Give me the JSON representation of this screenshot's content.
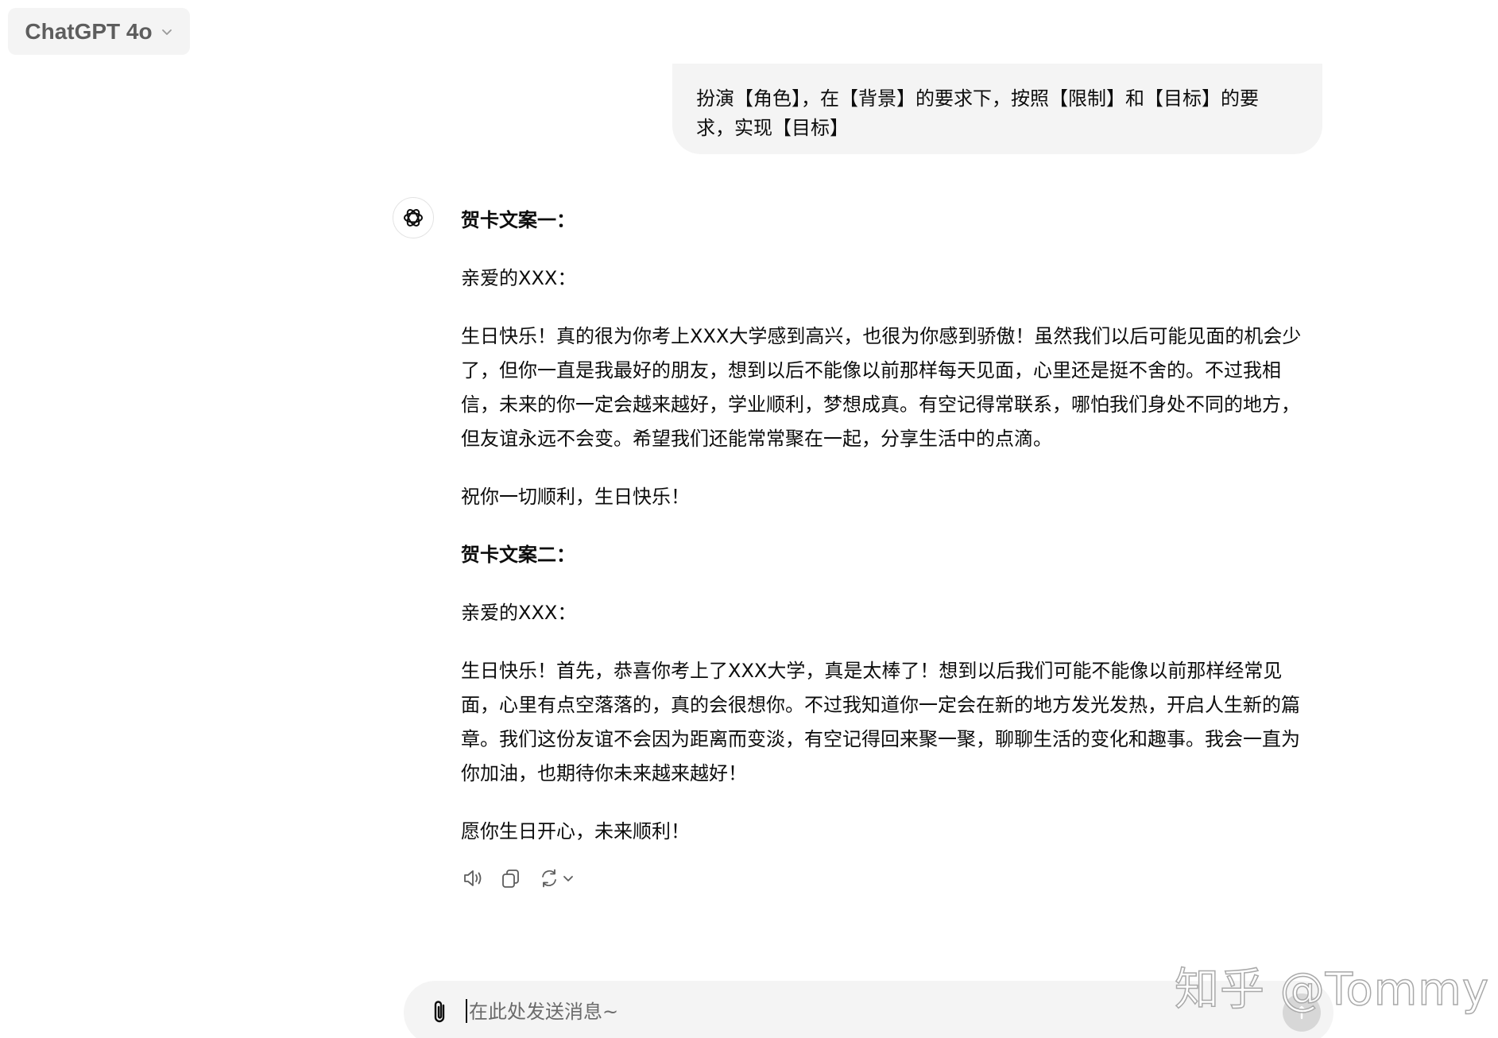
{
  "header": {
    "model_label": "ChatGPT 4o"
  },
  "conversation": {
    "user_message": "扮演【角色】，在【背景】的要求下，按照【限制】和【目标】的要求，实现【目标】",
    "assistant": {
      "card1": {
        "heading": "贺卡文案一：",
        "salutation": "亲爱的XXX：",
        "body": "生日快乐！真的很为你考上XXX大学感到高兴，也很为你感到骄傲！虽然我们以后可能见面的机会少了，但你一直是我最好的朋友，想到以后不能像以前那样每天见面，心里还是挺不舍的。不过我相信，未来的你一定会越来越好，学业顺利，梦想成真。有空记得常联系，哪怕我们身处不同的地方，但友谊永远不会变。希望我们还能常常聚在一起，分享生活中的点滴。",
        "closing": "祝你一切顺利，生日快乐！"
      },
      "card2": {
        "heading": "贺卡文案二：",
        "salutation": "亲爱的XXX：",
        "body": "生日快乐！首先，恭喜你考上了XXX大学，真是太棒了！想到以后我们可能不能像以前那样经常见面，心里有点空落落的，真的会很想你。不过我知道你一定会在新的地方发光发热，开启人生新的篇章。我们这份友谊不会因为距离而变淡，有空记得回来聚一聚，聊聊生活的变化和趣事。我会一直为你加油，也期待你未来越来越好！",
        "closing": "愿你生日开心，未来顺利！"
      },
      "actions": [
        "speaker-icon",
        "copy-icon",
        "regenerate-icon",
        "chevron-down-icon"
      ]
    }
  },
  "composer": {
    "placeholder": "在此处发送消息~",
    "value": ""
  },
  "watermark": {
    "text": "知乎 @Tommy"
  },
  "colors": {
    "bubble_bg": "#f4f4f4",
    "text": "#0d0d0d",
    "muted": "#5d5d5d",
    "send_disabled": "#d7d7d7"
  }
}
